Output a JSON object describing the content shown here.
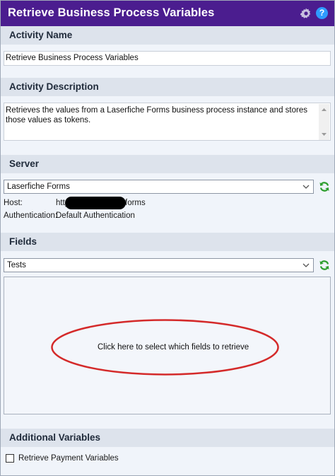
{
  "window": {
    "title": "Retrieve Business Process Variables",
    "gear_icon": "gear-icon",
    "help_icon": "help-icon",
    "help_glyph": "?"
  },
  "activity_name": {
    "header": "Activity Name",
    "value": "Retrieve Business Process Variables"
  },
  "activity_description": {
    "header": "Activity Description",
    "value": "Retrieves the values from a Laserfiche Forms business process instance and stores those values as tokens."
  },
  "server": {
    "header": "Server",
    "selected": "Laserfiche Forms",
    "host_label": "Host:",
    "host_prefix": "http",
    "host_suffix": "forms",
    "auth_label": "Authentication:",
    "auth_value": "Default Authentication"
  },
  "fields": {
    "header": "Fields",
    "selected": "Tests",
    "prompt": "Click here to select which fields to retrieve"
  },
  "additional_variables": {
    "header": "Additional Variables",
    "checkbox_label": "Retrieve Payment Variables",
    "checked": false
  },
  "colors": {
    "titlebar": "#4b1d8f",
    "section_header": "#dde3ec",
    "background": "#f0f4fa",
    "annotation_ellipse": "#d42a2a",
    "refresh_green": "#2e9e2e",
    "help_blue": "#2f9bff"
  }
}
